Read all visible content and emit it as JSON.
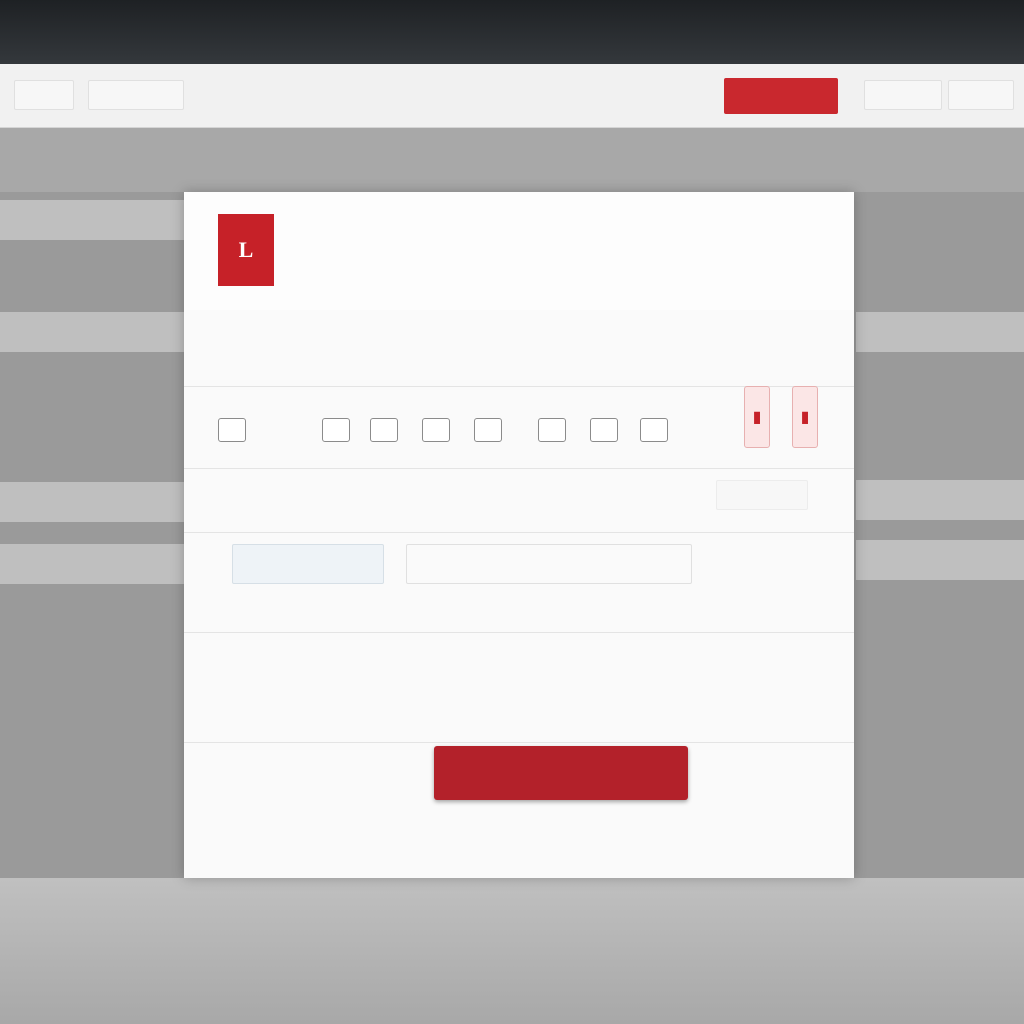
{
  "nav": {
    "items": [
      "",
      "",
      "",
      "",
      ""
    ],
    "primary_label": "",
    "right_items": [
      "",
      ""
    ]
  },
  "side_left": [
    "",
    "",
    "",
    ""
  ],
  "side_right": [
    "",
    "",
    ""
  ],
  "modal": {
    "logo_letter": "L",
    "title": "",
    "info": {
      "caption": "",
      "left": "",
      "mid": "",
      "right": "",
      "sub": ""
    },
    "code_labels": [
      "",
      "",
      "",
      "",
      "",
      "",
      "",
      ""
    ],
    "labels": [
      "",
      "",
      "",
      ""
    ],
    "input_a_value": "",
    "input_b_value": "",
    "summary": {
      "k1": "",
      "v1": "",
      "k2": "",
      "v2": ""
    },
    "submit_label": "",
    "footer_left": "",
    "footer_text": ""
  },
  "colors": {
    "accent": "#c62128",
    "button": "#b3212a"
  }
}
